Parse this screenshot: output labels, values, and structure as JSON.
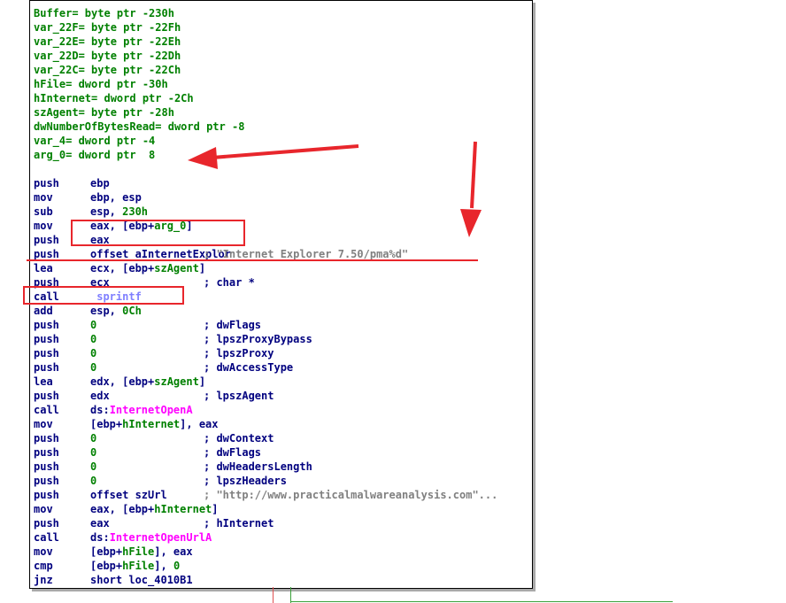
{
  "vars": [
    {
      "name": "Buffer",
      "def": "= byte ptr -230h"
    },
    {
      "name": "var_22F",
      "def": "= byte ptr -22Fh"
    },
    {
      "name": "var_22E",
      "def": "= byte ptr -22Eh"
    },
    {
      "name": "var_22D",
      "def": "= byte ptr -22Dh"
    },
    {
      "name": "var_22C",
      "def": "= byte ptr -22Ch"
    },
    {
      "name": "hFile",
      "def": "= dword ptr -30h"
    },
    {
      "name": "hInternet",
      "def": "= dword ptr -2Ch"
    },
    {
      "name": "szAgent",
      "def": "= byte ptr -28h"
    },
    {
      "name": "dwNumberOfBytesRead",
      "def": "= dword ptr -8"
    },
    {
      "name": "var_4",
      "def": "= dword ptr -4"
    },
    {
      "name": "arg_0",
      "def": "= dword ptr  8"
    }
  ],
  "code": [
    {
      "m": "push",
      "o": [
        [
          "ebp",
          "kw"
        ]
      ]
    },
    {
      "m": "mov",
      "o": [
        [
          "ebp, esp",
          "kw"
        ]
      ]
    },
    {
      "m": "sub",
      "o": [
        [
          "esp, ",
          "kw"
        ],
        [
          "230h",
          "num"
        ]
      ]
    },
    {
      "m": "mov",
      "o": [
        [
          "eax, [ebp+",
          "kw"
        ],
        [
          "arg_0",
          "num"
        ],
        [
          "]",
          "kw"
        ]
      ]
    },
    {
      "m": "push",
      "o": [
        [
          "eax",
          "kw"
        ]
      ]
    },
    {
      "m": "push",
      "o": [
        [
          "offset aInternetExplor",
          "kw"
        ]
      ],
      "c": [
        [
          "; ",
          "gray"
        ],
        [
          "\"Internet Explorer 7.50/pma%d\"",
          "str"
        ]
      ]
    },
    {
      "m": "lea",
      "o": [
        [
          "ecx, [ebp+",
          "kw"
        ],
        [
          "szAgent",
          "num"
        ],
        [
          "]",
          "kw"
        ]
      ]
    },
    {
      "m": "push",
      "o": [
        [
          "ecx",
          "kw"
        ]
      ],
      "c": [
        [
          "; char *",
          "cmt"
        ]
      ]
    },
    {
      "m": "call",
      "o": [
        [
          " sprintf",
          "fn"
        ]
      ]
    },
    {
      "m": "add",
      "o": [
        [
          "esp, ",
          "kw"
        ],
        [
          "0Ch",
          "num"
        ]
      ]
    },
    {
      "m": "push",
      "o": [
        [
          "0",
          "num"
        ]
      ],
      "c": [
        [
          "; dwFlags",
          "cmt"
        ]
      ]
    },
    {
      "m": "push",
      "o": [
        [
          "0",
          "num"
        ]
      ],
      "c": [
        [
          "; lpszProxyBypass",
          "cmt"
        ]
      ]
    },
    {
      "m": "push",
      "o": [
        [
          "0",
          "num"
        ]
      ],
      "c": [
        [
          "; lpszProxy",
          "cmt"
        ]
      ]
    },
    {
      "m": "push",
      "o": [
        [
          "0",
          "num"
        ]
      ],
      "c": [
        [
          "; dwAccessType",
          "cmt"
        ]
      ]
    },
    {
      "m": "lea",
      "o": [
        [
          "edx, [ebp+",
          "kw"
        ],
        [
          "szAgent",
          "num"
        ],
        [
          "]",
          "kw"
        ]
      ]
    },
    {
      "m": "push",
      "o": [
        [
          "edx",
          "kw"
        ]
      ],
      "c": [
        [
          "; lpszAgent",
          "cmt"
        ]
      ]
    },
    {
      "m": "call",
      "o": [
        [
          "ds:",
          "kw"
        ],
        [
          "InternetOpenA",
          "api"
        ]
      ]
    },
    {
      "m": "mov",
      "o": [
        [
          "[ebp+",
          "kw"
        ],
        [
          "hInternet",
          "num"
        ],
        [
          "], eax",
          "kw"
        ]
      ]
    },
    {
      "m": "push",
      "o": [
        [
          "0",
          "num"
        ]
      ],
      "c": [
        [
          "; dwContext",
          "cmt"
        ]
      ]
    },
    {
      "m": "push",
      "o": [
        [
          "0",
          "num"
        ]
      ],
      "c": [
        [
          "; dwFlags",
          "cmt"
        ]
      ]
    },
    {
      "m": "push",
      "o": [
        [
          "0",
          "num"
        ]
      ],
      "c": [
        [
          "; dwHeadersLength",
          "cmt"
        ]
      ]
    },
    {
      "m": "push",
      "o": [
        [
          "0",
          "num"
        ]
      ],
      "c": [
        [
          "; lpszHeaders",
          "cmt"
        ]
      ]
    },
    {
      "m": "push",
      "o": [
        [
          "offset szUrl",
          "kw"
        ]
      ],
      "c": [
        [
          "; ",
          "gray"
        ],
        [
          "\"http://www.practicalmalwareanalysis.com\"...",
          "str"
        ]
      ]
    },
    {
      "m": "mov",
      "o": [
        [
          "eax, [ebp+",
          "kw"
        ],
        [
          "hInternet",
          "num"
        ],
        [
          "]",
          "kw"
        ]
      ]
    },
    {
      "m": "push",
      "o": [
        [
          "eax",
          "kw"
        ]
      ],
      "c": [
        [
          "; hInternet",
          "cmt"
        ]
      ]
    },
    {
      "m": "call",
      "o": [
        [
          "ds:",
          "kw"
        ],
        [
          "InternetOpenUrlA",
          "api"
        ]
      ]
    },
    {
      "m": "mov",
      "o": [
        [
          "[ebp+",
          "kw"
        ],
        [
          "hFile",
          "num"
        ],
        [
          "], eax",
          "kw"
        ]
      ]
    },
    {
      "m": "cmp",
      "o": [
        [
          "[ebp+",
          "kw"
        ],
        [
          "hFile",
          "num"
        ],
        [
          "], ",
          "kw"
        ],
        [
          "0",
          "num"
        ]
      ]
    },
    {
      "m": "jnz",
      "o": [
        [
          "short loc_4010B1",
          "kw"
        ]
      ]
    }
  ],
  "colors": {
    "annotation": "#e8262c",
    "mnemonic": "#00007f",
    "name": "#008000",
    "api": "#ff00ff",
    "string": "#808080"
  }
}
